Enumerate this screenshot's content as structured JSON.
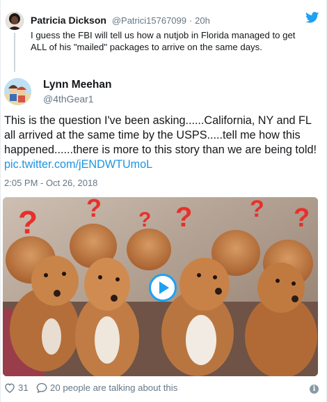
{
  "parent_tweet": {
    "name": "Patricia Dickson",
    "handle": "@Patrici15767099",
    "separator": "·",
    "time": "20h",
    "text": "I guess the FBI will tell us how a nutjob in Florida managed to get ALL of his \"mailed\" packages to arrive on the same days."
  },
  "tweet": {
    "name": "Lynn Meehan",
    "handle": "@4thGear1",
    "text": "This is the question I've been asking......California, NY and FL all arrived at the same time by the USPS.....tell me how this happened......there is more to this story than we are being told!",
    "link": "pic.twitter.com/jENDWTUmoL",
    "date": "2:05 PM - Oct 26, 2018"
  },
  "media": {
    "type": "video",
    "description_icon": "play-icon"
  },
  "footer": {
    "likes": "31",
    "talking": "20 people are talking about this"
  },
  "colors": {
    "accent": "#1da1f2",
    "link": "#1b95e0",
    "muted": "#657786",
    "question_mark": "#e8302b"
  }
}
